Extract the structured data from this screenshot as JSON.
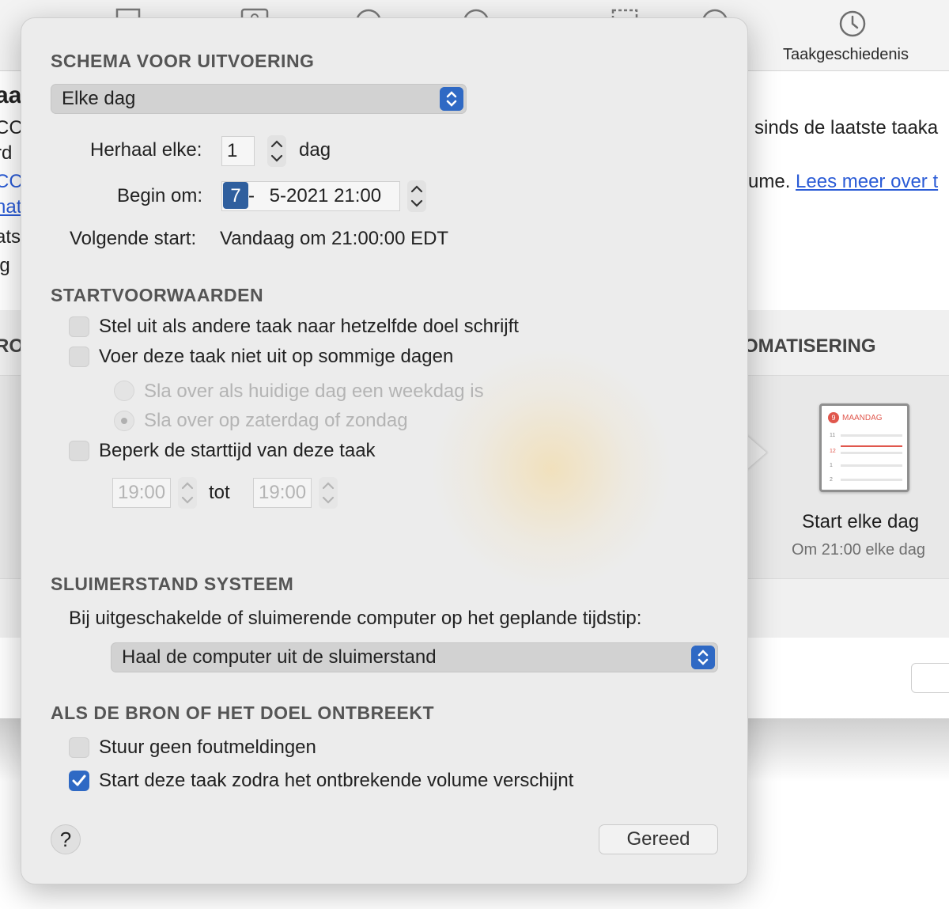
{
  "background": {
    "toolbar": {
      "history_label": "Taakgeschiedenis"
    },
    "left_fragments": [
      "aa",
      "CC",
      "rd",
      "CC",
      "nat",
      "ats",
      "lg",
      "RO"
    ],
    "right_line1": "sinds de laatste taaka",
    "right_line2_prefix": "ume.",
    "right_line2_link": "Lees meer over t",
    "section_header": "OMATISERING",
    "automation": {
      "calendar_day_number": "9",
      "calendar_day_name": "MAANDAG",
      "calendar_rows": [
        "11",
        "12",
        "1",
        "2"
      ],
      "title": "Start elke dag",
      "subtitle": "Om 21:00 elke dag"
    }
  },
  "popover": {
    "schedule": {
      "title": "SCHEMA VOOR UITVOERING",
      "frequency_value": "Elke dag",
      "repeat_label": "Herhaal elke:",
      "repeat_value": "1",
      "repeat_unit": "dag",
      "begin_label": "Begin om:",
      "begin_day": "7",
      "begin_sep": "-",
      "begin_rest": "5-2021 21:00",
      "next_label": "Volgende start:",
      "next_value": "Vandaag om 21:00:00 EDT"
    },
    "conditions": {
      "title": "STARTVOORWAARDEN",
      "opt1": "Stel uit als andere taak naar hetzelfde doel schrijft",
      "opt2": "Voer deze taak niet uit op sommige dagen",
      "radio1": "Sla over als huidige dag een weekdag is",
      "radio2": "Sla over op zaterdag of zondag",
      "opt3": "Beperk de starttijd van deze taak",
      "time_from": "19:00",
      "time_to_label": "tot",
      "time_to": "19:00"
    },
    "sleep": {
      "title": "SLUIMERSTAND SYSTEEM",
      "description": "Bij uitgeschakelde of sluimerende computer op het geplande tijdstip:",
      "action_value": "Haal de computer uit de sluimerstand"
    },
    "missing": {
      "title": "ALS DE BRON OF HET DOEL ONTBREEKT",
      "opt1": "Stuur geen foutmeldingen",
      "opt2": "Start deze taak zodra het ontbrekende volume verschijnt"
    },
    "help_label": "?",
    "done_label": "Gereed"
  },
  "colors": {
    "accent": "#2f69c4",
    "link": "#2a5bd6",
    "calendar_red": "#e0574d"
  }
}
